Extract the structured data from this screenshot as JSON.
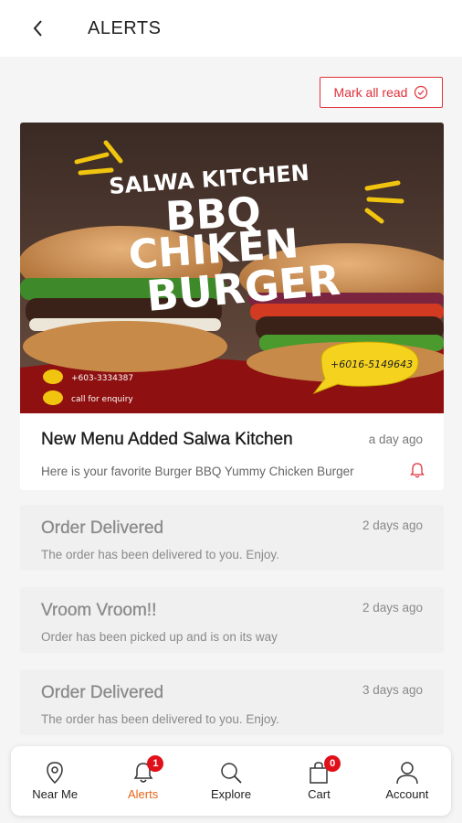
{
  "header": {
    "title": "ALERTS"
  },
  "mark_all_read": {
    "label": "Mark all read"
  },
  "featured": {
    "banner": {
      "brand": "SALWA KITCHEN",
      "line1": "BBQ",
      "line2": "CHIKEN",
      "line3": "BURGER",
      "phone1": "+603-3334387",
      "enquiry": "call for enquiry",
      "phone2": "+6016-5149643"
    },
    "title": "New Menu Added Salwa Kitchen",
    "time": "a day ago",
    "message": "Here is your favorite Burger BBQ Yummy Chicken Burger"
  },
  "notifications": [
    {
      "title": "Order Delivered",
      "time": "2 days ago",
      "message": "The order has been delivered to you. Enjoy."
    },
    {
      "title": "Vroom Vroom!!",
      "time": "2 days ago",
      "message": "Order has been picked up and is on its way"
    },
    {
      "title": "Order Delivered",
      "time": "3 days ago",
      "message": "The order has been delivered to you. Enjoy."
    }
  ],
  "nav": {
    "items": [
      {
        "label": "Near Me"
      },
      {
        "label": "Alerts",
        "badge": "1"
      },
      {
        "label": "Explore"
      },
      {
        "label": "Cart",
        "badge": "0"
      },
      {
        "label": "Account"
      }
    ]
  },
  "colors": {
    "accent": "#e0303a",
    "active_nav": "#e8651a",
    "banner_red": "#8e1010"
  }
}
